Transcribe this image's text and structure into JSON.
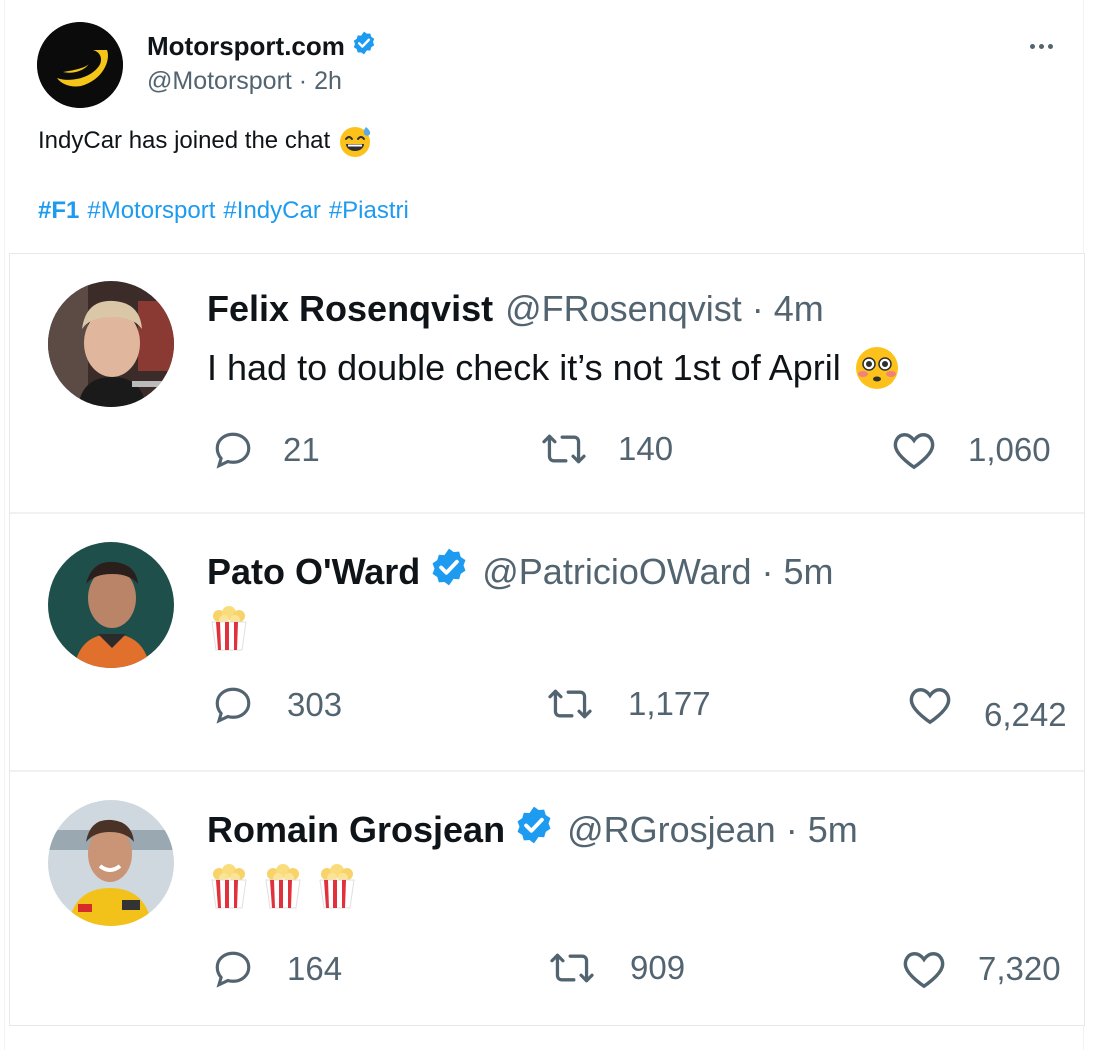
{
  "tweet": {
    "author_name": "Motorsport.com",
    "handle_time": "@Motorsport · 2h",
    "text": "IndyCar has joined the chat",
    "text_emoji": "grinning-sweat-emoji",
    "hashtags": [
      "#F1",
      "#Motorsport",
      "#IndyCar",
      "#Piastri"
    ],
    "verified": true
  },
  "replies": [
    {
      "name": "Felix Rosenqvist",
      "handle_time": "@FRosenqvist · 4m",
      "text": "I had to double check it’s not 1st of April",
      "emoji": "flushed-face-emoji",
      "verified": false,
      "replies": "21",
      "retweets": "140",
      "likes": "1,060"
    },
    {
      "name": "Pato O'Ward",
      "handle_time": "@PatricioOWard · 5m",
      "text": "",
      "emoji": "popcorn-emoji",
      "popcorn_count": 1,
      "verified": true,
      "replies": "303",
      "retweets": "1,177",
      "likes": "6,242"
    },
    {
      "name": "Romain Grosjean",
      "handle_time": "@RGrosjean · 5m",
      "text": "",
      "emoji": "popcorn-emoji",
      "popcorn_count": 3,
      "verified": true,
      "replies": "164",
      "retweets": "909",
      "likes": "7,320"
    }
  ],
  "colors": {
    "link": "#1d9bf0",
    "verified": "#1d9bf0",
    "secondary_text": "#536471",
    "primary_text": "#0f1419",
    "brand_yellow": "#f5c518"
  }
}
